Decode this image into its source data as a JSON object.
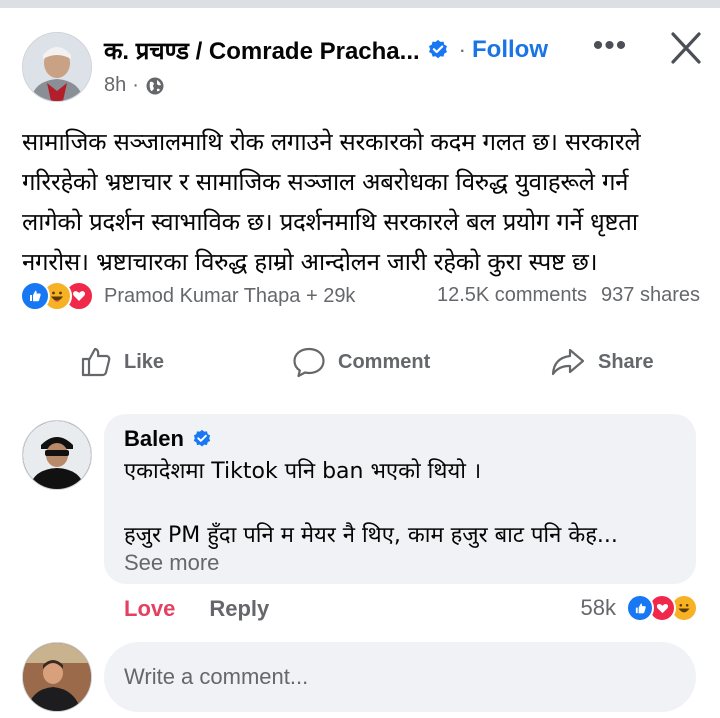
{
  "post": {
    "author": "क. प्रचण्ड / Comrade Pracha...",
    "follow_label": "Follow",
    "separator": "·",
    "time": "8h",
    "more_label": "•••",
    "text_lines": [
      "सामाजिक सञ्जालमाथि रोक लगाउने सरकारको कदम गलत छ। सरकारले",
      "गरिरहेको भ्रष्टाचार र सामाजिक सञ्जाल अबरोधका विरुद्ध युवाहरूले गर्न",
      "लागेको प्रदर्शन स्वाभाविक छ। प्रदर्शनमाथि सरकारले बल प्रयोग गर्ने धृष्टता",
      "नगरोस। भ्रष्टाचारका विरुद्ध हाम्रो आन्दोलन जारी रहेको कुरा स्पष्ट छ।"
    ],
    "reactors": "Pramod Kumar Thapa + 29k",
    "comments_count": "12.5K comments",
    "shares_count": "937 shares"
  },
  "actions": {
    "like": "Like",
    "comment": "Comment",
    "share": "Share"
  },
  "comment": {
    "author": "Balen",
    "line1": "एकादेशमा Tiktok पनि ban भएको थियो ।",
    "line2": "हजुर PM हुँदा पनि म मेयर नै थिए, काम हजुर बाट पनि केह...",
    "see_more": "See more",
    "love_label": "Love",
    "reply_label": "Reply",
    "reaction_count": "58k"
  },
  "composer": {
    "placeholder": "Write a comment..."
  },
  "colors": {
    "accent": "#1b74e4",
    "like": "#1877f2",
    "love": "#f0284a",
    "haha": "#f7b125",
    "bubble": "#f0f2f5",
    "muted": "#65676b"
  }
}
